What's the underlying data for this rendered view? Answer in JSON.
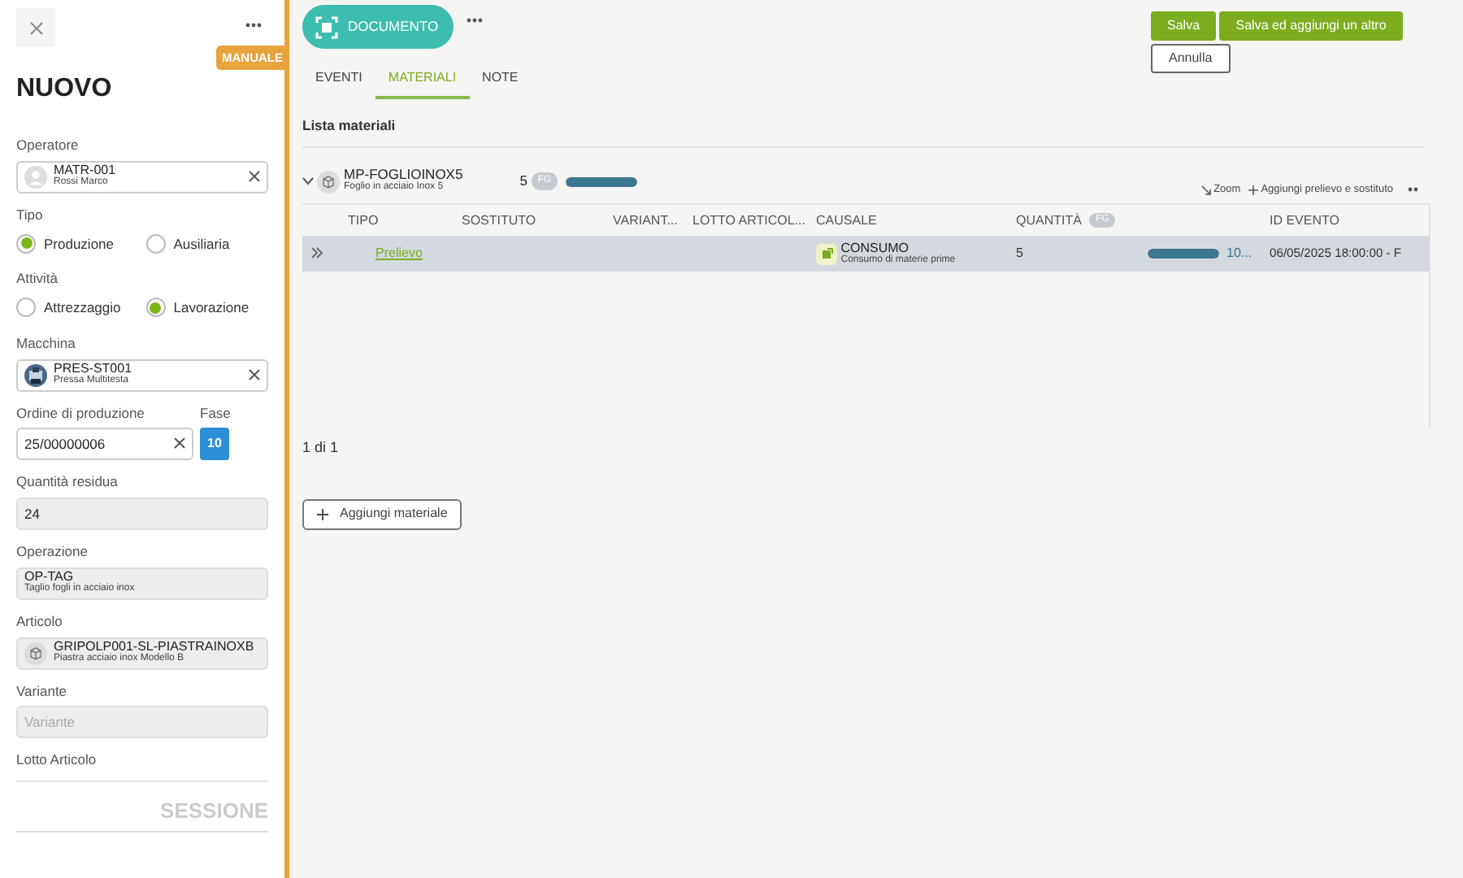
{
  "sidebar": {
    "title": "NUOVO",
    "badge": "MANUALE",
    "footer": "SESSIONE",
    "fields": [
      {
        "kind": "operator",
        "label": "Operatore",
        "value": "MATR-001",
        "sub": "Rossi Marco",
        "readonly": false
      },
      {
        "kind": "radio",
        "label": "Tipo",
        "options": [
          {
            "label": "Produzione",
            "selected": true
          },
          {
            "label": "Ausiliaria",
            "selected": false
          }
        ]
      },
      {
        "kind": "radio",
        "label": "Attività",
        "options": [
          {
            "label": "Attrezzaggio",
            "selected": false
          },
          {
            "label": "Lavorazione",
            "selected": true
          }
        ]
      },
      {
        "kind": "machine",
        "label": "Macchina",
        "value": "PRES-ST001",
        "sub": "Pressa Multitesta",
        "readonly": false
      },
      {
        "kind": "order",
        "label": "Ordine di produzione",
        "value": "25/00000006",
        "phase_label": "Fase",
        "phase": "10"
      },
      {
        "kind": "text",
        "label": "Quantità residua",
        "value": "24"
      },
      {
        "kind": "lookup",
        "label": "Operazione",
        "value": "OP-TAG",
        "sub": "Taglio fogli in acciaio inox",
        "readonly": true
      },
      {
        "kind": "article",
        "label": "Articolo",
        "value": "GRIPOLP001-SL-PIASTRAINOXB",
        "sub": "Piastra acciaio inox Modello B",
        "readonly": true
      },
      {
        "kind": "text",
        "label": "Variante",
        "placeholder": "Variante"
      },
      {
        "kind": "label",
        "label": "Lotto Articolo"
      }
    ]
  },
  "header": {
    "document": "DOCUMENTO",
    "buttons": [
      {
        "label": "Salva",
        "kind": "primary"
      },
      {
        "label": "Salva ed aggiungi un altro",
        "kind": "primary"
      },
      {
        "label": "Annulla",
        "kind": "outline"
      }
    ]
  },
  "tabs": [
    {
      "label": "EVENTI",
      "selected": false
    },
    {
      "label": "MATERIALI",
      "selected": true
    },
    {
      "label": "NOTE",
      "selected": false
    }
  ],
  "section_title": "Lista materiali",
  "material": {
    "code": "MP-FOGLIOINOX5",
    "description": "Foglio in acciaio Inox 5",
    "quantity": "5",
    "unit": "FG",
    "level": 1,
    "actions": [
      "Zoom",
      "Aggiungi prelievo e sostituto"
    ]
  },
  "table": {
    "columns": [
      "TIPO",
      "SOSTITUTO",
      "VARIANT...",
      "LOTTO ARTICOL...",
      "CAUSALE",
      "QUANTITÀ",
      "ID EVENTO"
    ],
    "quantity_unit": "FG",
    "rows": [
      {
        "selected": true,
        "tipo": "Prelievo",
        "causale": "CONSUMO",
        "causale_sub": "Consumo di materie prime",
        "quantita": "5",
        "level": 1,
        "progress": "10...",
        "id_evento": "06/05/2025 18:00:00 - F"
      }
    ]
  },
  "pagination": "1 di 1",
  "add_button": "Aggiungi materiale"
}
